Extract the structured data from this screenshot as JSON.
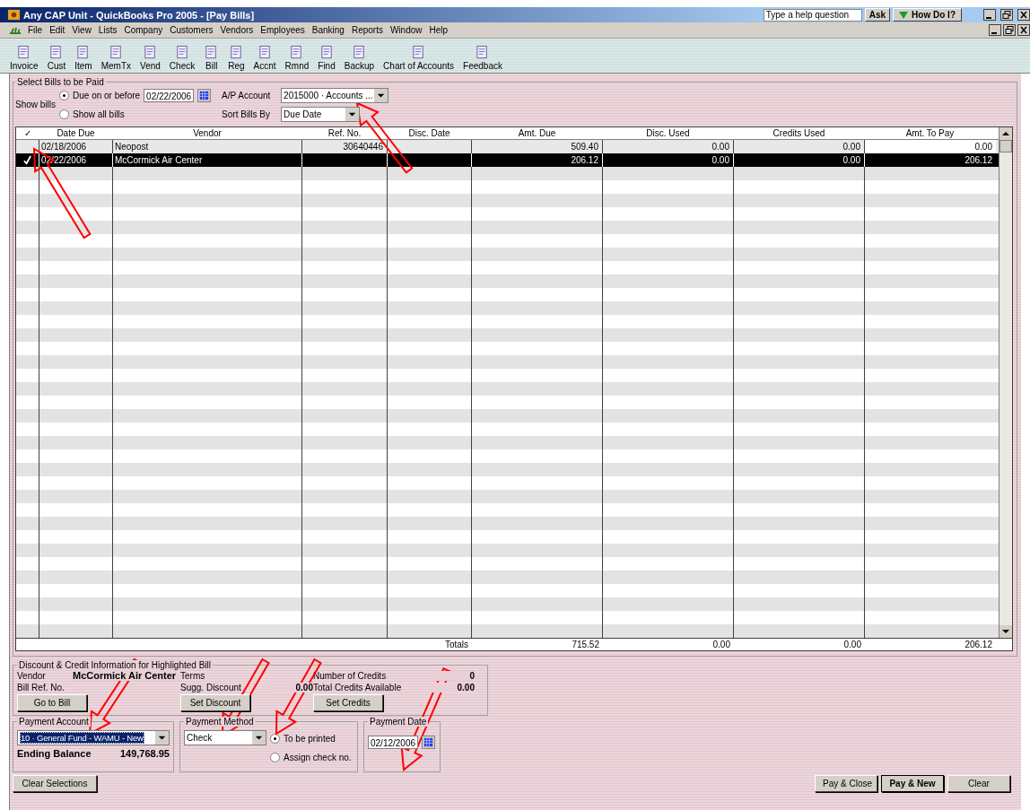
{
  "window": {
    "title": "Any CAP Unit - QuickBooks Pro 2005 - [Pay Bills]"
  },
  "help": {
    "placeholder": "Type a help question",
    "ask": "Ask",
    "how_do_i": "How Do I?"
  },
  "menu": [
    "File",
    "Edit",
    "View",
    "Lists",
    "Company",
    "Customers",
    "Vendors",
    "Employees",
    "Banking",
    "Reports",
    "Window",
    "Help"
  ],
  "toolbar": [
    "Invoice",
    "Cust",
    "Item",
    "MemTx",
    "Vend",
    "Check",
    "Bill",
    "Reg",
    "Accnt",
    "Rmnd",
    "Find",
    "Backup",
    "Chart of Accounts",
    "Feedback"
  ],
  "select_bills": {
    "title": "Select Bills to be Paid",
    "show_bills_label": "Show bills",
    "options": [
      {
        "label": "Due on or before",
        "selected": true
      },
      {
        "label": "Show all bills",
        "selected": false
      }
    ],
    "due_date": "02/22/2006",
    "ap_account_label": "A/P Account",
    "ap_account": "2015000 · Accounts ...",
    "sort_label": "Sort Bills By",
    "sort_by": "Due Date"
  },
  "table": {
    "check_header": "✓",
    "columns": [
      "Date Due",
      "Vendor",
      "Ref. No.",
      "Disc. Date",
      "Amt. Due",
      "Disc. Used",
      "Credits Used",
      "Amt. To Pay"
    ],
    "rows": [
      {
        "checked": false,
        "selected": false,
        "cells": [
          "02/18/2006",
          "Neopost",
          "30640446",
          "",
          "509.40",
          "0.00",
          "0.00",
          "0.00"
        ]
      },
      {
        "checked": true,
        "selected": true,
        "cells": [
          "02/22/2006",
          "McCormick Air Center",
          "",
          "",
          "206.12",
          "0.00",
          "0.00",
          "206.12"
        ]
      }
    ],
    "totals_label": "Totals",
    "totals": [
      "715.52",
      "0.00",
      "0.00",
      "206.12"
    ]
  },
  "discount_credit": {
    "title": "Discount & Credit Information for Highlighted Bill",
    "vendor_label": "Vendor",
    "vendor": "McCormick Air Center",
    "bill_ref_label": "Bill Ref. No.",
    "terms_label": "Terms",
    "sugg_discount_label": "Sugg. Discount",
    "sugg_discount": "0.00",
    "credits_count_label": "Number of Credits",
    "credits_count": "0",
    "credits_available_label": "Total Credits Available",
    "credits_available": "0.00",
    "buttons": [
      "Go to Bill",
      "Set Discount",
      "Set Credits"
    ]
  },
  "payment_account": {
    "title": "Payment Account",
    "account": "10 · General Fund - WAMU - New",
    "balance_label": "Ending Balance",
    "balance": "149,768.95"
  },
  "payment_method": {
    "title": "Payment Method",
    "method": "Check",
    "options": [
      {
        "label": "To be printed",
        "selected": true
      },
      {
        "label": "Assign check no.",
        "selected": false
      }
    ]
  },
  "payment_date": {
    "title": "Payment Date",
    "date": "02/12/2006"
  },
  "buttons": {
    "clear_selections": "Clear Selections",
    "actions": [
      {
        "label": "Pay & Close",
        "default": false
      },
      {
        "label": "Pay & New",
        "default": true
      },
      {
        "label": "Clear",
        "default": false
      }
    ]
  }
}
